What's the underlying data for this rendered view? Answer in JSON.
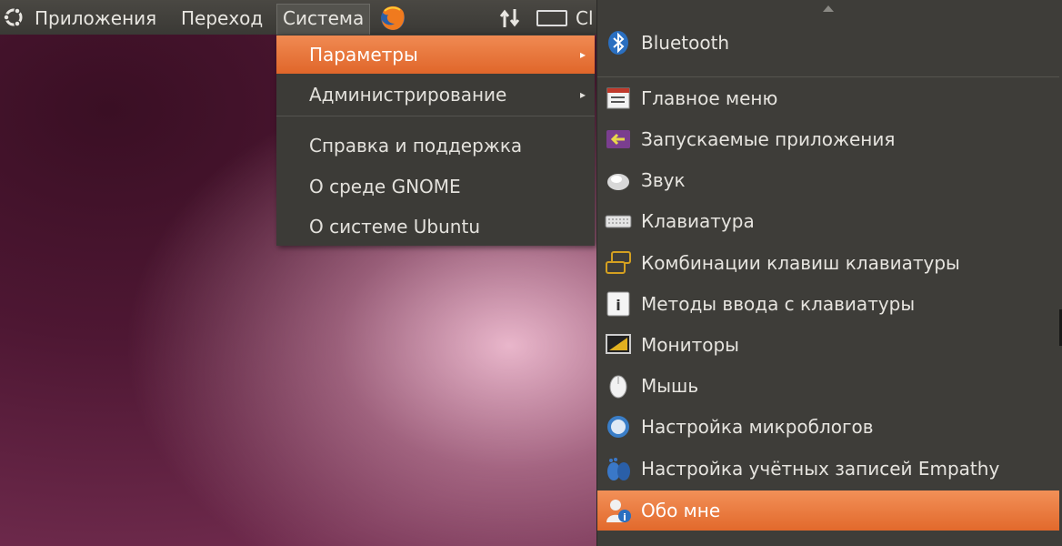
{
  "panel": {
    "menus": [
      "Приложения",
      "Переход",
      "Система"
    ],
    "clipped_text": "Cl"
  },
  "system_menu": {
    "items": [
      {
        "label": "Параметры",
        "submenu": true
      },
      {
        "label": "Администрирование",
        "submenu": true
      },
      {
        "label": "Справка и поддержка",
        "submenu": false
      },
      {
        "label": "О среде GNOME",
        "submenu": false
      },
      {
        "label": "О системе Ubuntu",
        "submenu": false
      }
    ],
    "highlighted": "Параметры"
  },
  "preferences_menu": {
    "items": [
      {
        "label": "Bluetooth",
        "icon": "bluetooth-icon"
      },
      {
        "label": "Главное меню",
        "icon": "main-menu-icon"
      },
      {
        "label": "Запускаемые приложения",
        "icon": "startup-apps-icon"
      },
      {
        "label": "Звук",
        "icon": "sound-icon"
      },
      {
        "label": "Клавиатура",
        "icon": "keyboard-icon"
      },
      {
        "label": "Комбинации клавиш клавиатуры",
        "icon": "keyboard-shortcuts-icon"
      },
      {
        "label": "Методы ввода с клавиатуры",
        "icon": "input-methods-icon"
      },
      {
        "label": "Мониторы",
        "icon": "monitors-icon"
      },
      {
        "label": "Мышь",
        "icon": "mouse-icon"
      },
      {
        "label": "Настройка микроблогов",
        "icon": "microblog-icon"
      },
      {
        "label": "Настройка учётных записей Empathy",
        "icon": "empathy-accounts-icon"
      },
      {
        "label": "Обо мне",
        "icon": "about-me-icon"
      }
    ],
    "highlighted": "Обо мне"
  },
  "colors": {
    "highlight": "#e8743a",
    "menu_bg": "#3c3b37",
    "panel_bg": "#3f3e3a"
  }
}
